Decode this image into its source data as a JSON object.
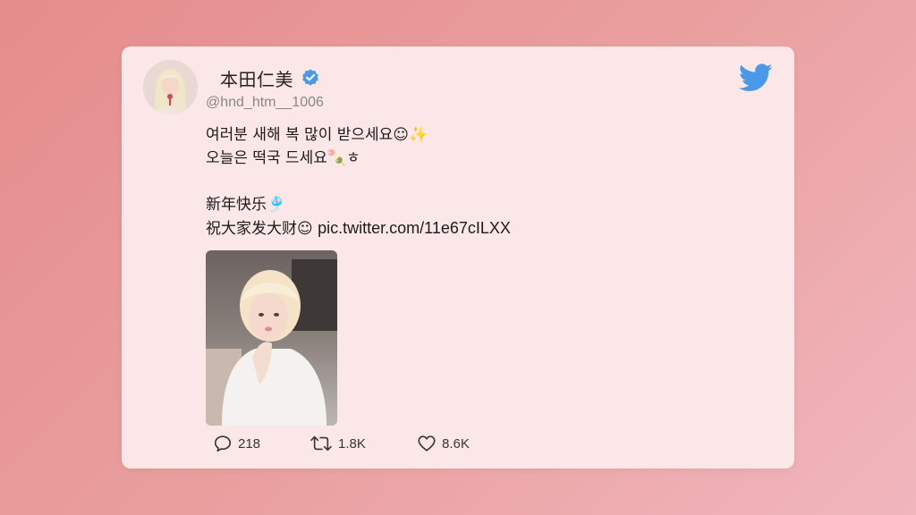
{
  "tweet": {
    "display_name": "本田仁美",
    "handle": "@hnd_htm__1006",
    "text_lines": [
      "여러분 새해 복 많이 받으세요☺✨",
      "오늘은 떡국 드세요🍡ㅎ",
      "",
      "新年快乐🎐",
      "祝大家发大财☺ "
    ],
    "link": "pic.twitter.com/11e67cILXX",
    "verified": true
  },
  "stats": {
    "replies": "218",
    "retweets": "1.8K",
    "likes": "8.6K"
  },
  "icons": {
    "brand": "twitter-bird-icon",
    "verified": "verified-badge-icon",
    "reply": "reply-icon",
    "retweet": "retweet-icon",
    "like": "heart-icon"
  },
  "colors": {
    "background_start": "#e58c8c",
    "background_end": "#f0b6bd",
    "card": "#fbe7e7",
    "twitter_blue": "#4a99e9",
    "text": "#1e1a1a",
    "muted": "#8b8787"
  }
}
